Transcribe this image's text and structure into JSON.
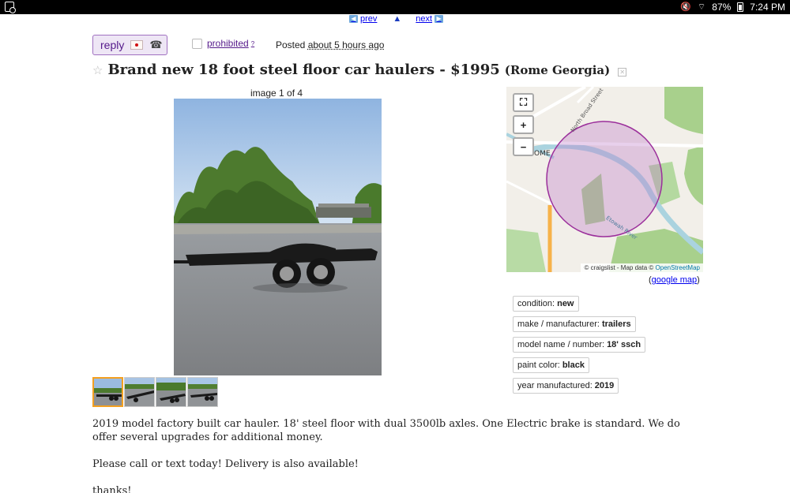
{
  "status_bar": {
    "battery": "87%",
    "time": "7:24 PM"
  },
  "pager": {
    "prev_label": "prev",
    "next_label": "next"
  },
  "actions": {
    "reply_label": "reply",
    "prohibited_label": "prohibited",
    "prohibited_help": "?",
    "posted_prefix": "Posted",
    "posted_time": "about 5 hours ago"
  },
  "listing": {
    "title": "Brand new 18 foot steel floor car haulers - $1995",
    "location": "(Rome Georgia)"
  },
  "gallery": {
    "image_count": "image 1 of 4",
    "thumbnail_count": 4
  },
  "map": {
    "place_label": "OME",
    "road_labels": [
      "North Broad Street",
      "Etowah River"
    ],
    "attribution_prefix": "© craigslist - Map data ©",
    "attribution_link": "OpenStreetMap",
    "google_link": "google map",
    "google_prefix": "(",
    "google_suffix": ")"
  },
  "attributes": [
    {
      "label": "condition:",
      "value": "new"
    },
    {
      "label": "make / manufacturer:",
      "value": "trailers"
    },
    {
      "label": "model name / number:",
      "value": "18' ssch"
    },
    {
      "label": "paint color:",
      "value": "black"
    },
    {
      "label": "year manufactured:",
      "value": "2019"
    }
  ],
  "description": [
    "2019 model factory built car hauler. 18' steel floor with dual 3500lb axles. One Electric brake is standard. We do offer several upgrades for additional money.",
    "Please call or text today! Delivery is also available!",
    "thanks!"
  ],
  "colors": {
    "link": "#0000ee",
    "visited_link": "#551a8b",
    "reply_bg": "#eee6f5",
    "thumb_active_border": "#f4a020",
    "map_circle": "#9b2f9b"
  }
}
